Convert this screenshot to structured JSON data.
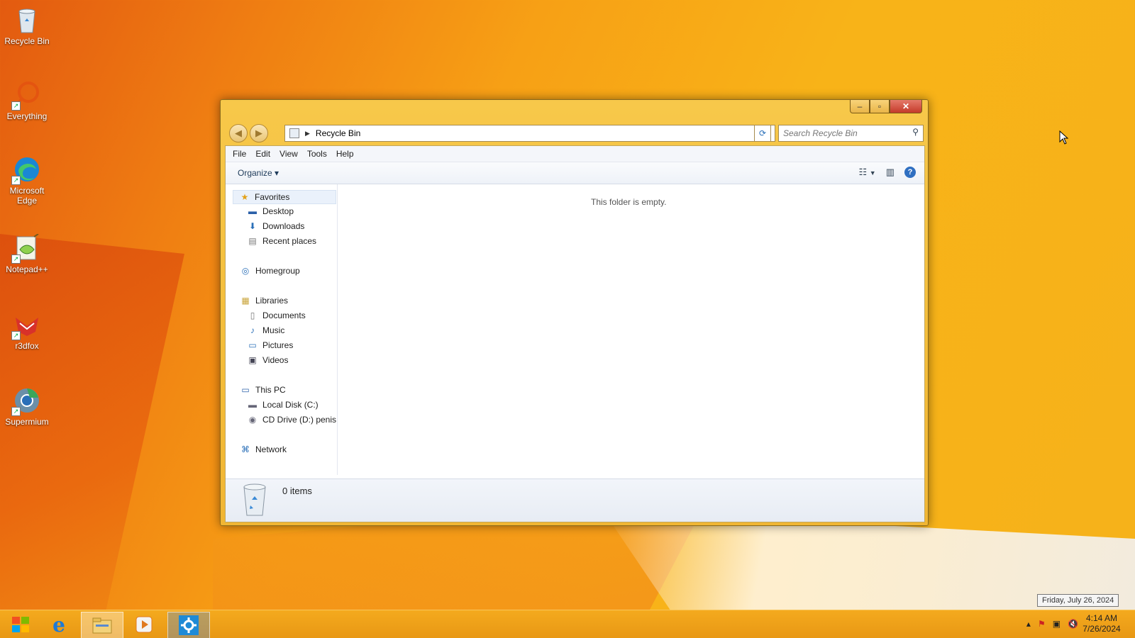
{
  "desktop": {
    "icons": [
      {
        "label": "Recycle Bin",
        "icon": "recycle-bin-icon"
      },
      {
        "label": "Everything",
        "icon": "everything-search-icon"
      },
      {
        "label": "Microsoft Edge",
        "icon": "edge-icon"
      },
      {
        "label": "Notepad++",
        "icon": "notepadpp-icon"
      },
      {
        "label": "r3dfox",
        "icon": "r3dfox-icon"
      },
      {
        "label": "Supermium",
        "icon": "supermium-icon"
      }
    ]
  },
  "window": {
    "address": {
      "location": "Recycle Bin"
    },
    "search": {
      "placeholder": "Search Recycle Bin"
    },
    "menu": [
      "File",
      "Edit",
      "View",
      "Tools",
      "Help"
    ],
    "toolbar": {
      "organize_label": "Organize"
    },
    "nav": {
      "favorites": "Favorites",
      "desktop": "Desktop",
      "downloads": "Downloads",
      "recent": "Recent places",
      "homegroup": "Homegroup",
      "libraries": "Libraries",
      "documents": "Documents",
      "music": "Music",
      "pictures": "Pictures",
      "videos": "Videos",
      "thispc": "This PC",
      "localdisk": "Local Disk (C:)",
      "cddrive": "CD Drive (D:) penis",
      "network": "Network"
    },
    "empty_message": "This folder is empty.",
    "details": {
      "count": "0 items"
    }
  },
  "taskbar": {
    "time": "4:14 AM",
    "date": "7/26/2024",
    "tooltip": "Friday, July 26, 2024"
  },
  "colors": {
    "accent": "#f4b520",
    "taskbar": "#ee9f18",
    "link": "#2f6fc1"
  }
}
